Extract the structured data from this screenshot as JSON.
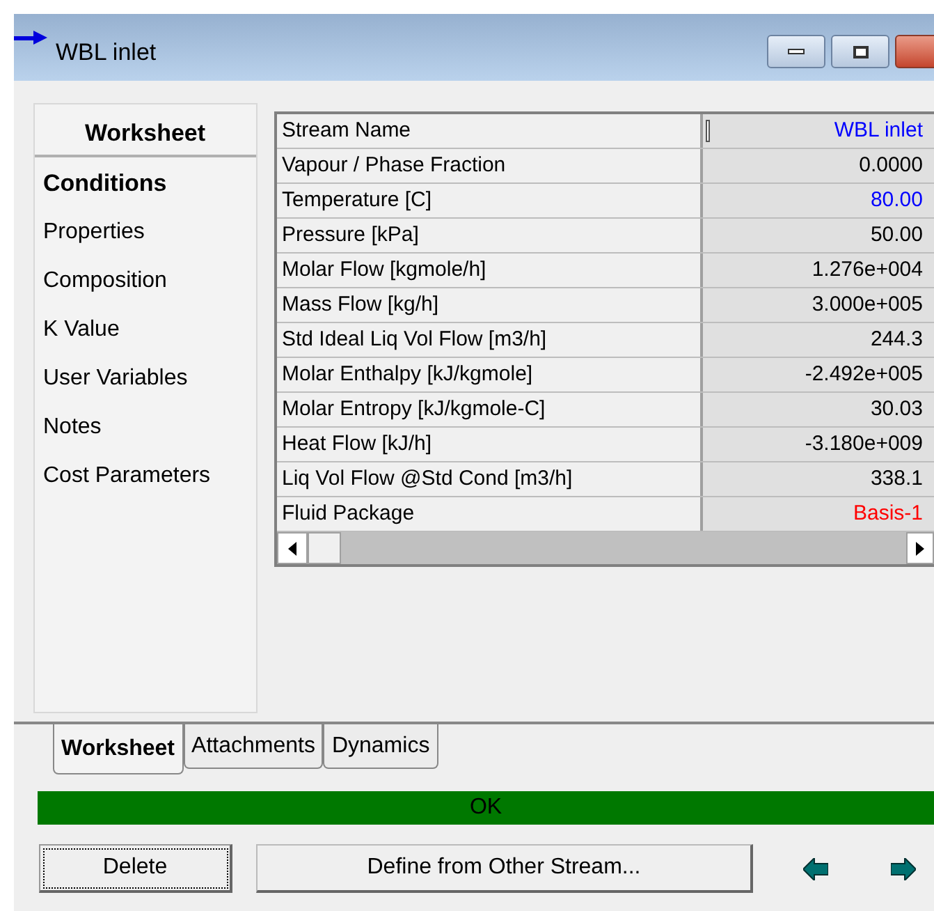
{
  "window": {
    "title": "WBL inlet"
  },
  "side_panel": {
    "header": "Worksheet",
    "items": [
      {
        "label": "Conditions",
        "selected": true
      },
      {
        "label": "Properties",
        "selected": false
      },
      {
        "label": "Composition",
        "selected": false
      },
      {
        "label": "K Value",
        "selected": false
      },
      {
        "label": "User Variables",
        "selected": false
      },
      {
        "label": "Notes",
        "selected": false
      },
      {
        "label": "Cost Parameters",
        "selected": false
      }
    ]
  },
  "table": {
    "rows": [
      {
        "name": "Stream Name",
        "value": "WBL inlet",
        "color": "#0000ff"
      },
      {
        "name": "Vapour / Phase Fraction",
        "value": "0.0000",
        "color": "#000000"
      },
      {
        "name": "Temperature [C]",
        "value": "80.00",
        "color": "#0000ff"
      },
      {
        "name": "Pressure [kPa]",
        "value": "50.00",
        "color": "#000000"
      },
      {
        "name": "Molar Flow [kgmole/h]",
        "value": "1.276e+004",
        "color": "#000000"
      },
      {
        "name": "Mass Flow [kg/h]",
        "value": "3.000e+005",
        "color": "#000000"
      },
      {
        "name": "Std Ideal Liq Vol Flow [m3/h]",
        "value": "244.3",
        "color": "#000000"
      },
      {
        "name": "Molar Enthalpy [kJ/kgmole]",
        "value": "-2.492e+005",
        "color": "#000000"
      },
      {
        "name": "Molar Entropy [kJ/kgmole-C]",
        "value": "30.03",
        "color": "#000000"
      },
      {
        "name": "Heat Flow [kJ/h]",
        "value": "-3.180e+009",
        "color": "#000000"
      },
      {
        "name": "Liq Vol Flow @Std Cond [m3/h]",
        "value": "338.1",
        "color": "#000000"
      },
      {
        "name": "Fluid Package",
        "value": "Basis-1",
        "color": "#ff0000"
      }
    ]
  },
  "tabs": [
    {
      "label": "Worksheet",
      "selected": true
    },
    {
      "label": "Attachments",
      "selected": false
    },
    {
      "label": "Dynamics",
      "selected": false
    }
  ],
  "status_bar": {
    "text": "OK"
  },
  "buttons": [
    "Delete",
    "Define from Other Stream..."
  ]
}
